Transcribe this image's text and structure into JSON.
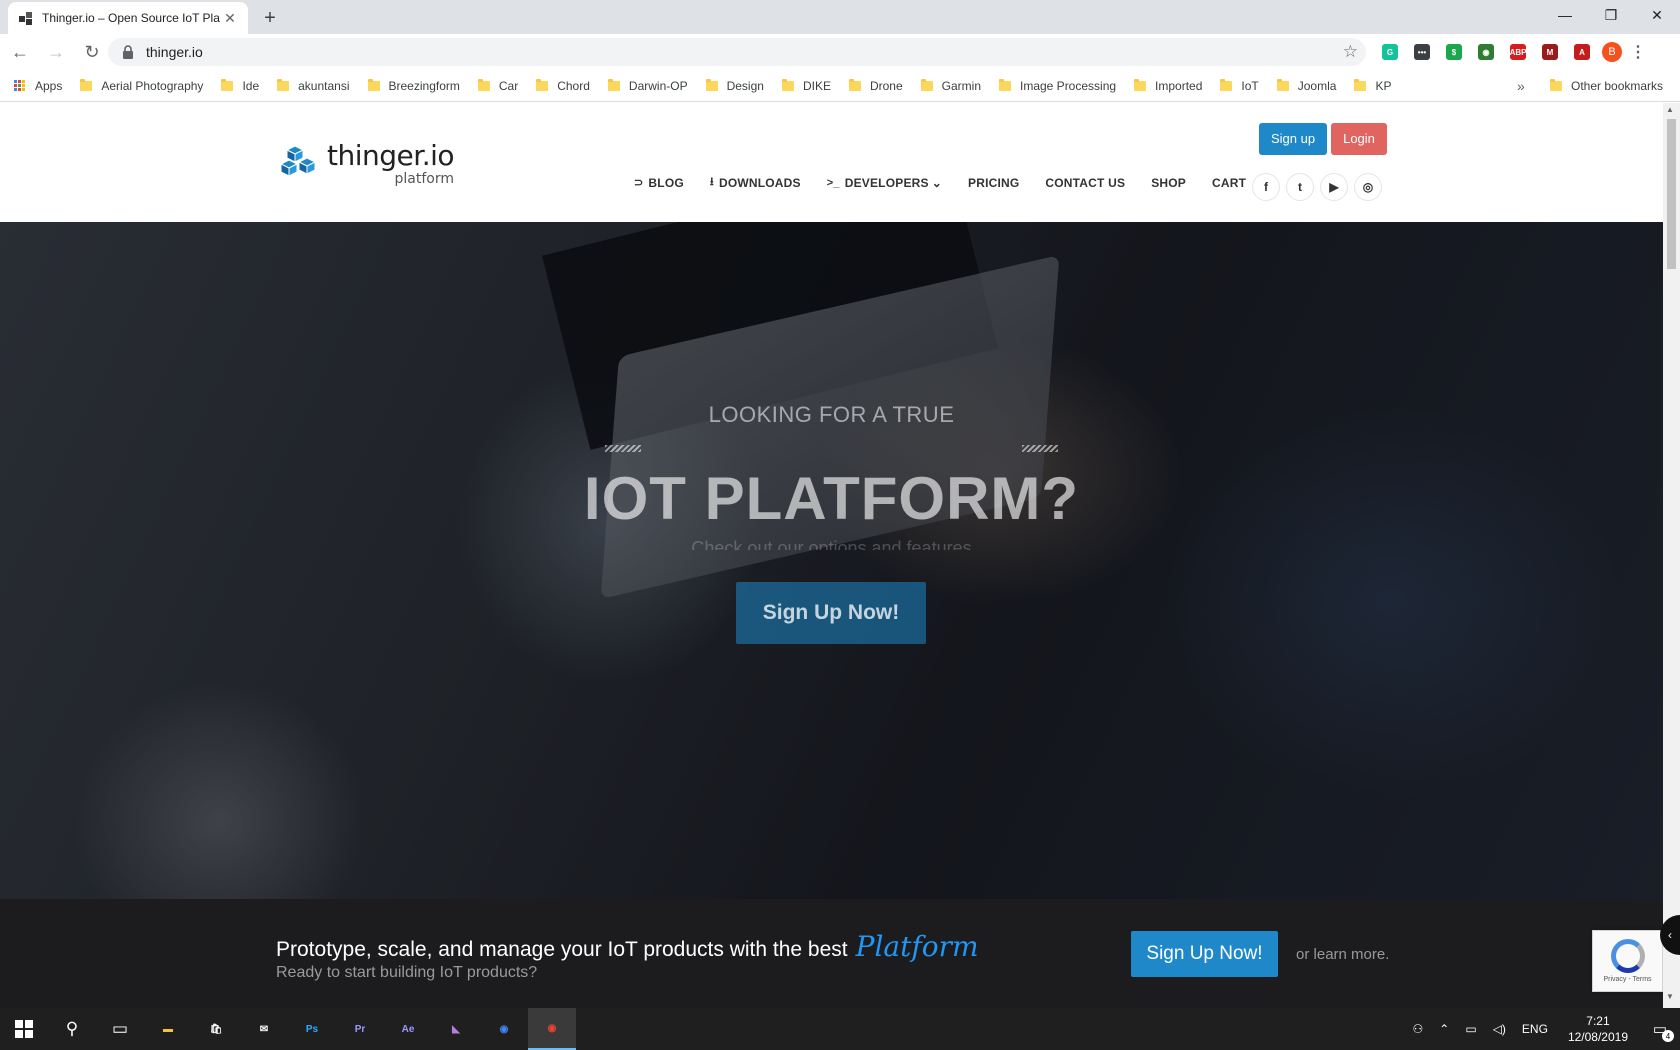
{
  "browser": {
    "tab_title": "Thinger.io – Open Source IoT Pla",
    "url": "thinger.io",
    "profile_initial": "B",
    "extensions": [
      {
        "name": "grammarly-icon",
        "color": "#15c39a",
        "label": "G"
      },
      {
        "name": "extension-dots-icon",
        "color": "#3c4043",
        "label": "•••"
      },
      {
        "name": "extension-green-icon",
        "color": "#1aa84f",
        "label": "$"
      },
      {
        "name": "extension-globe-icon",
        "color": "#2e7d32",
        "label": "◉"
      },
      {
        "name": "adblock-plus-icon",
        "color": "#d61e1e",
        "label": "ABP"
      },
      {
        "name": "mendeley-icon",
        "color": "#9b1b1b",
        "label": "M"
      },
      {
        "name": "acrobat-icon",
        "color": "#c51d1d",
        "label": "A"
      }
    ]
  },
  "bookmarks": {
    "apps_label": "Apps",
    "items": [
      "Aerial Photography",
      "Ide",
      "akuntansi",
      "Breezingform",
      "Car",
      "Chord",
      "Darwin-OP",
      "Design",
      "DIKE",
      "Drone",
      "Garmin",
      "Image Processing",
      "Imported",
      "IoT",
      "Joomla",
      "KP"
    ],
    "more": "»",
    "other": "Other bookmarks"
  },
  "site": {
    "logo_name": "thinger.io",
    "logo_sub": "platform",
    "auth": {
      "signup": "Sign up",
      "login": "Login"
    },
    "nav": [
      {
        "label": "BLOG",
        "icon": "rss-icon",
        "glyph": "⊃"
      },
      {
        "label": "DOWNLOADS",
        "icon": "download-icon",
        "glyph": "⭳"
      },
      {
        "label": "DEVELOPERS",
        "icon": "terminal-icon",
        "glyph": ">_",
        "dropdown": true
      },
      {
        "label": "PRICING"
      },
      {
        "label": "CONTACT US"
      },
      {
        "label": "SHOP"
      },
      {
        "label": "CART"
      }
    ],
    "socials": [
      {
        "name": "facebook-icon",
        "glyph": "f"
      },
      {
        "name": "twitter-icon",
        "glyph": "t"
      },
      {
        "name": "youtube-icon",
        "glyph": "▶"
      },
      {
        "name": "instagram-icon",
        "glyph": "◎"
      }
    ]
  },
  "hero": {
    "small_heading": "LOOKING FOR A TRUE",
    "big_heading": "IOT PLATFORM?",
    "subheading": "Check out our options and features",
    "cta": "Sign Up Now!"
  },
  "promo": {
    "title": "Prototype, scale, and manage your IoT products with the best",
    "accent": "Platform",
    "subtitle": "Ready to start building IoT products?",
    "cta": "Sign Up Now!",
    "more_prefix": "or",
    "more_link": "learn more."
  },
  "recaptcha": {
    "text": "Privacy - Terms"
  },
  "taskbar": {
    "apps": [
      {
        "name": "file-explorer-icon",
        "color": "#f4c542",
        "glyph": "▬"
      },
      {
        "name": "store-icon",
        "color": "#ffffff",
        "glyph": "🛍"
      },
      {
        "name": "mail-icon",
        "color": "#ffffff",
        "glyph": "✉"
      },
      {
        "name": "photoshop-icon",
        "color": "#31a8ff",
        "glyph": "Ps"
      },
      {
        "name": "premiere-icon",
        "color": "#9999ff",
        "glyph": "Pr"
      },
      {
        "name": "after-effects-icon",
        "color": "#9999ff",
        "glyph": "Ae"
      },
      {
        "name": "visual-studio-icon",
        "color": "#b07fe0",
        "glyph": "◣"
      },
      {
        "name": "chrome-blue-icon",
        "color": "#4285f4",
        "glyph": "◉"
      },
      {
        "name": "chrome-icon",
        "color": "#ea4335",
        "glyph": "◉",
        "active": true
      }
    ],
    "lang": "ENG",
    "time": "7:21",
    "date": "12/08/2019",
    "notifications": "4"
  }
}
